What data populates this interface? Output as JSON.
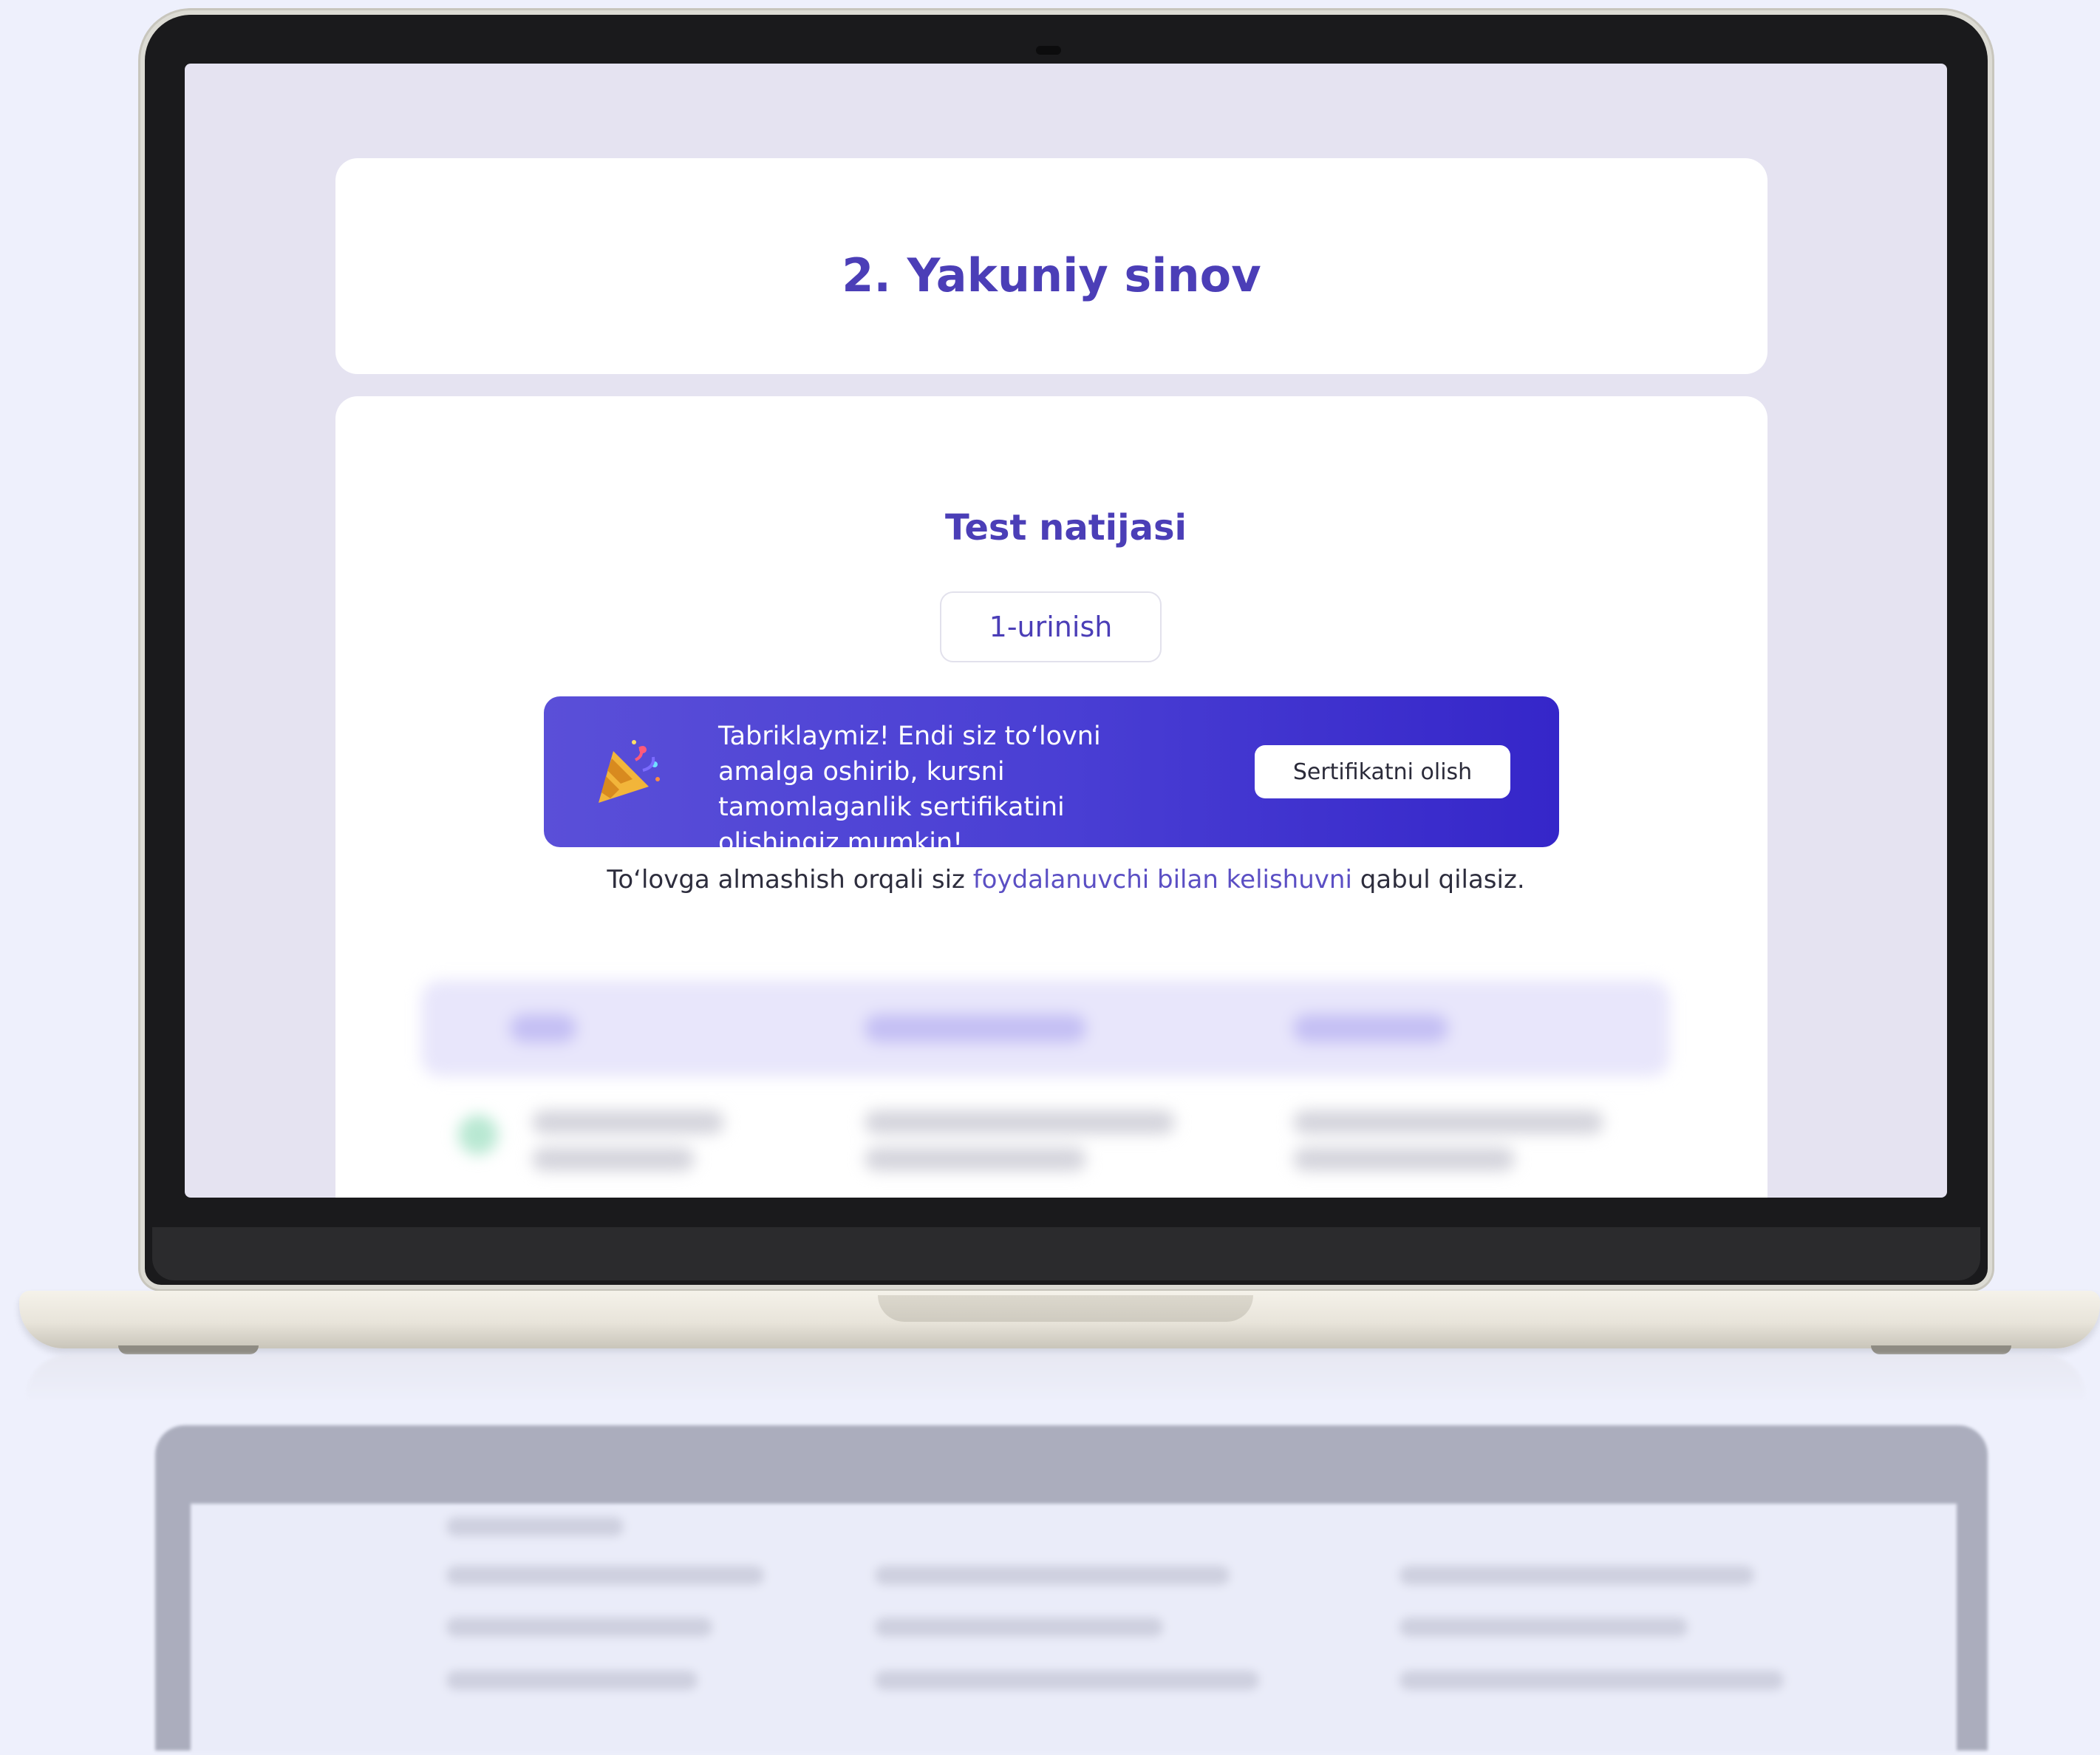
{
  "page": {
    "title": "2. Yakuniy sinov"
  },
  "result": {
    "heading": "Test natijasi",
    "attempt_label": "1-urinish"
  },
  "banner": {
    "icon": "party-popper-icon",
    "message": "Tabriklaymiz! Endi siz to‘lovni amalga oshirib, kursni tamomlaganlik sertifikatini olishingiz mumkin!",
    "button_label": "Sertifikatni olish",
    "gradient_start": "#5a4fd8",
    "gradient_end": "#3526c9"
  },
  "agreement": {
    "prefix": "To‘lovga almashish orqali siz ",
    "link_text": "foydalanuvchi bilan kelishuvni",
    "suffix": " qabul qilasiz."
  },
  "colors": {
    "accent": "#4b3eb7",
    "link": "#5b4fc4",
    "screen_bg": "#e5e3f1",
    "page_bg": "#eef0fc"
  }
}
